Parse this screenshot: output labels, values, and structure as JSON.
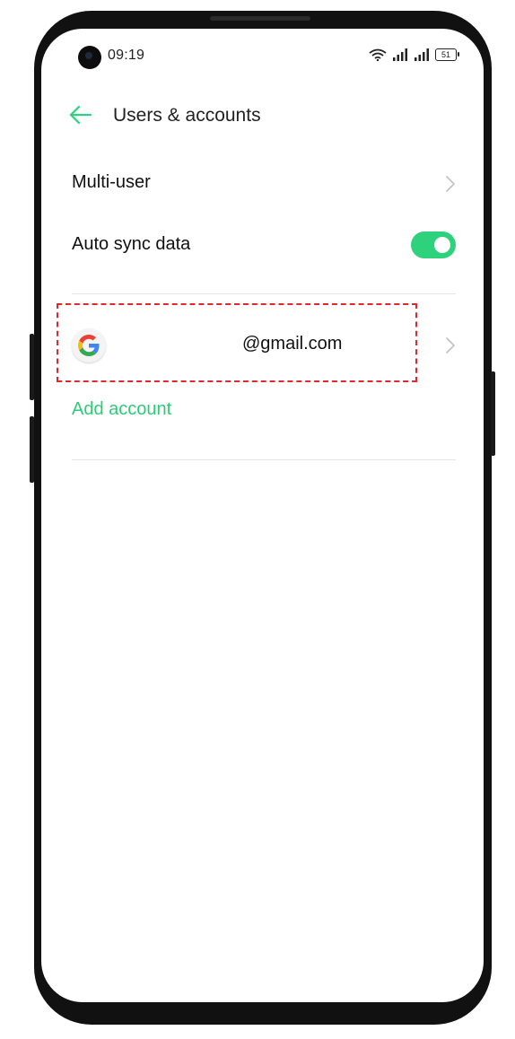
{
  "status_bar": {
    "time": "09:19",
    "battery": "51"
  },
  "header": {
    "title": "Users & accounts"
  },
  "settings": {
    "multi_user_label": "Multi-user",
    "auto_sync_label": "Auto sync data",
    "auto_sync_enabled": true
  },
  "accounts": {
    "google_email": "@gmail.com",
    "add_account_label": "Add account"
  },
  "colors": {
    "accent": "#2ed17c",
    "highlight": "#e0282e"
  },
  "icons": {
    "back": "back-arrow-icon",
    "chevron": "chevron-right-icon",
    "google": "google-icon"
  }
}
